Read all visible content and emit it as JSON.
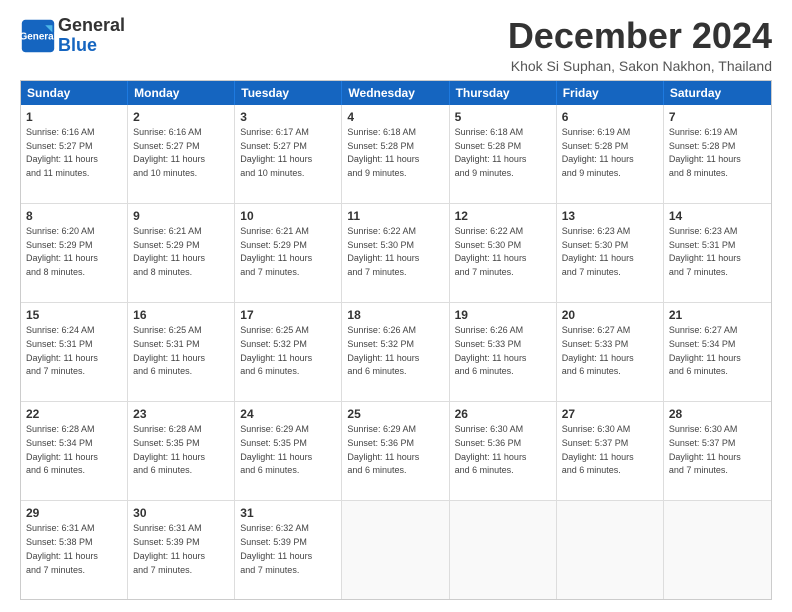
{
  "logo": {
    "line1": "General",
    "line2": "Blue"
  },
  "title": "December 2024",
  "subtitle": "Khok Si Suphan, Sakon Nakhon, Thailand",
  "days": [
    "Sunday",
    "Monday",
    "Tuesday",
    "Wednesday",
    "Thursday",
    "Friday",
    "Saturday"
  ],
  "weeks": [
    [
      {
        "day": "1",
        "sunrise": "6:16 AM",
        "sunset": "5:27 PM",
        "daylight": "11 hours and 11 minutes."
      },
      {
        "day": "2",
        "sunrise": "6:16 AM",
        "sunset": "5:27 PM",
        "daylight": "11 hours and 10 minutes."
      },
      {
        "day": "3",
        "sunrise": "6:17 AM",
        "sunset": "5:27 PM",
        "daylight": "11 hours and 10 minutes."
      },
      {
        "day": "4",
        "sunrise": "6:18 AM",
        "sunset": "5:28 PM",
        "daylight": "11 hours and 9 minutes."
      },
      {
        "day": "5",
        "sunrise": "6:18 AM",
        "sunset": "5:28 PM",
        "daylight": "11 hours and 9 minutes."
      },
      {
        "day": "6",
        "sunrise": "6:19 AM",
        "sunset": "5:28 PM",
        "daylight": "11 hours and 9 minutes."
      },
      {
        "day": "7",
        "sunrise": "6:19 AM",
        "sunset": "5:28 PM",
        "daylight": "11 hours and 8 minutes."
      }
    ],
    [
      {
        "day": "8",
        "sunrise": "6:20 AM",
        "sunset": "5:29 PM",
        "daylight": "11 hours and 8 minutes."
      },
      {
        "day": "9",
        "sunrise": "6:21 AM",
        "sunset": "5:29 PM",
        "daylight": "11 hours and 8 minutes."
      },
      {
        "day": "10",
        "sunrise": "6:21 AM",
        "sunset": "5:29 PM",
        "daylight": "11 hours and 7 minutes."
      },
      {
        "day": "11",
        "sunrise": "6:22 AM",
        "sunset": "5:30 PM",
        "daylight": "11 hours and 7 minutes."
      },
      {
        "day": "12",
        "sunrise": "6:22 AM",
        "sunset": "5:30 PM",
        "daylight": "11 hours and 7 minutes."
      },
      {
        "day": "13",
        "sunrise": "6:23 AM",
        "sunset": "5:30 PM",
        "daylight": "11 hours and 7 minutes."
      },
      {
        "day": "14",
        "sunrise": "6:23 AM",
        "sunset": "5:31 PM",
        "daylight": "11 hours and 7 minutes."
      }
    ],
    [
      {
        "day": "15",
        "sunrise": "6:24 AM",
        "sunset": "5:31 PM",
        "daylight": "11 hours and 7 minutes."
      },
      {
        "day": "16",
        "sunrise": "6:25 AM",
        "sunset": "5:31 PM",
        "daylight": "11 hours and 6 minutes."
      },
      {
        "day": "17",
        "sunrise": "6:25 AM",
        "sunset": "5:32 PM",
        "daylight": "11 hours and 6 minutes."
      },
      {
        "day": "18",
        "sunrise": "6:26 AM",
        "sunset": "5:32 PM",
        "daylight": "11 hours and 6 minutes."
      },
      {
        "day": "19",
        "sunrise": "6:26 AM",
        "sunset": "5:33 PM",
        "daylight": "11 hours and 6 minutes."
      },
      {
        "day": "20",
        "sunrise": "6:27 AM",
        "sunset": "5:33 PM",
        "daylight": "11 hours and 6 minutes."
      },
      {
        "day": "21",
        "sunrise": "6:27 AM",
        "sunset": "5:34 PM",
        "daylight": "11 hours and 6 minutes."
      }
    ],
    [
      {
        "day": "22",
        "sunrise": "6:28 AM",
        "sunset": "5:34 PM",
        "daylight": "11 hours and 6 minutes."
      },
      {
        "day": "23",
        "sunrise": "6:28 AM",
        "sunset": "5:35 PM",
        "daylight": "11 hours and 6 minutes."
      },
      {
        "day": "24",
        "sunrise": "6:29 AM",
        "sunset": "5:35 PM",
        "daylight": "11 hours and 6 minutes."
      },
      {
        "day": "25",
        "sunrise": "6:29 AM",
        "sunset": "5:36 PM",
        "daylight": "11 hours and 6 minutes."
      },
      {
        "day": "26",
        "sunrise": "6:30 AM",
        "sunset": "5:36 PM",
        "daylight": "11 hours and 6 minutes."
      },
      {
        "day": "27",
        "sunrise": "6:30 AM",
        "sunset": "5:37 PM",
        "daylight": "11 hours and 6 minutes."
      },
      {
        "day": "28",
        "sunrise": "6:30 AM",
        "sunset": "5:37 PM",
        "daylight": "11 hours and 7 minutes."
      }
    ],
    [
      {
        "day": "29",
        "sunrise": "6:31 AM",
        "sunset": "5:38 PM",
        "daylight": "11 hours and 7 minutes."
      },
      {
        "day": "30",
        "sunrise": "6:31 AM",
        "sunset": "5:39 PM",
        "daylight": "11 hours and 7 minutes."
      },
      {
        "day": "31",
        "sunrise": "6:32 AM",
        "sunset": "5:39 PM",
        "daylight": "11 hours and 7 minutes."
      },
      null,
      null,
      null,
      null
    ]
  ]
}
